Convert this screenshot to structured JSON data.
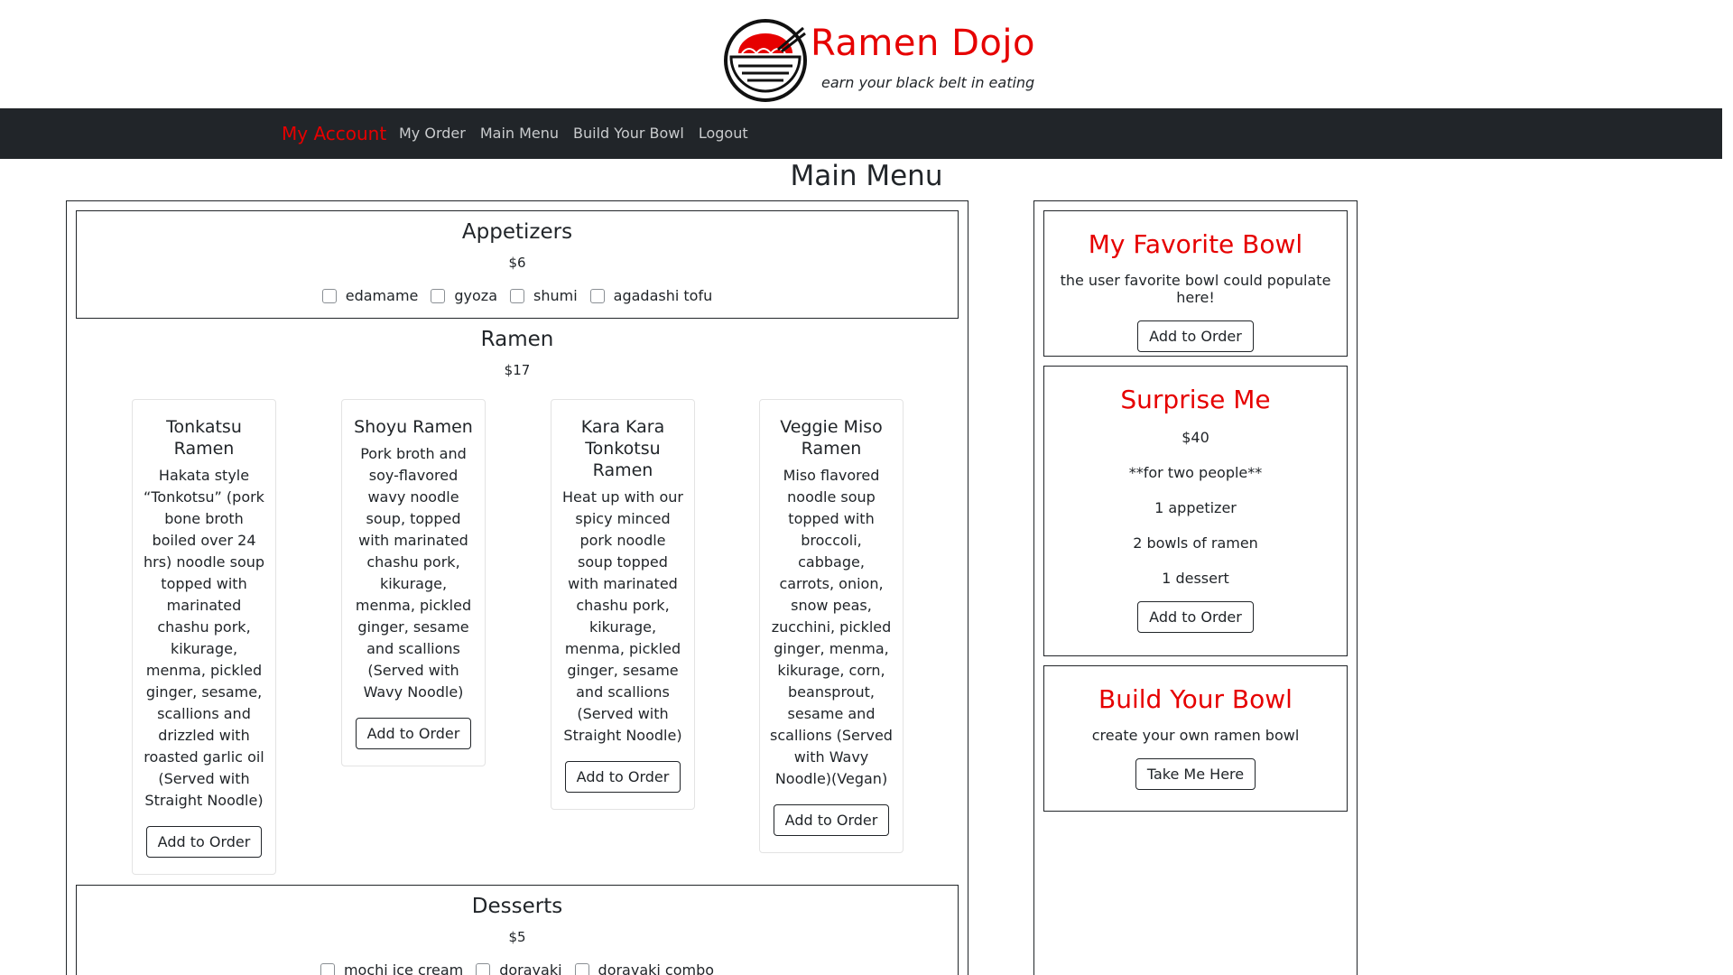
{
  "brand": {
    "title": "Ramen Dojo",
    "tagline": "earn your black belt in eating",
    "logo_icon": "ramen-bowl-logo",
    "accent_color": "#e60000"
  },
  "navbar": {
    "account": "My Account",
    "links": [
      "My Order",
      "Main Menu",
      "Build Your Bowl",
      "Logout"
    ]
  },
  "page": {
    "title": "Main Menu"
  },
  "appetizers": {
    "title": "Appetizers",
    "price": "$6",
    "items": [
      "edamame",
      "gyoza",
      "shumi",
      "agadashi tofu"
    ]
  },
  "ramen": {
    "title": "Ramen",
    "price": "$17",
    "cards": [
      {
        "name": "Tonkatsu Ramen",
        "desc": "Hakata style “Tonkotsu” (pork bone broth boiled over 24 hrs) noodle soup topped with marinated chashu pork, kikurage, menma, pickled ginger, sesame, scallions and drizzled with roasted garlic oil (Served with Straight Noodle)",
        "button": "Add to Order"
      },
      {
        "name": "Shoyu Ramen",
        "desc": "Pork broth and soy-flavored wavy noodle soup, topped with marinated chashu pork, kikurage, menma, pickled ginger, sesame and scallions (Served with Wavy Noodle)",
        "button": "Add to Order"
      },
      {
        "name": "Kara Kara Tonkotsu Ramen",
        "desc": "Heat up with our spicy minced pork noodle soup topped with marinated chashu pork, kikurage, menma, pickled ginger, sesame and scallions (Served with Straight Noodle)",
        "button": "Add to Order"
      },
      {
        "name": "Veggie Miso Ramen",
        "desc": "Miso flavored noodle soup topped with broccoli, cabbage, carrots, onion, snow peas, zucchini, pickled ginger, menma, kikurage, corn, beansprout, sesame and scallions (Served with Wavy Noodle)(Vegan)",
        "button": "Add to Order"
      }
    ]
  },
  "desserts": {
    "title": "Desserts",
    "price": "$5",
    "items": [
      "mochi ice cream",
      "dorayaki",
      "dorayaki combo"
    ]
  },
  "side": {
    "favorite": {
      "title": "My Favorite Bowl",
      "text": "the user favorite bowl could populate here!",
      "button": "Add to Order"
    },
    "surprise": {
      "title": "Surprise Me",
      "lines": [
        "$40",
        "**for two people**",
        "1 appetizer",
        "2 bowls of ramen",
        "1 dessert"
      ],
      "button": "Add to Order"
    },
    "build": {
      "title": "Build Your Bowl",
      "text": "create your own ramen bowl",
      "button": "Take Me Here"
    }
  }
}
